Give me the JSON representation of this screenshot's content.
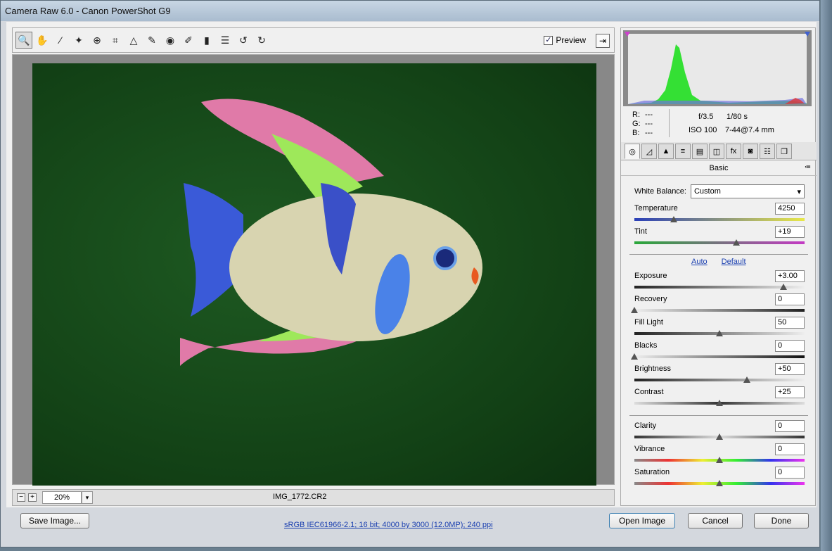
{
  "window": {
    "title": "Camera Raw 6.0  -  Canon PowerShot G9"
  },
  "toolbar": {
    "tools": [
      {
        "name": "zoom-tool",
        "icon": "magnifier-icon",
        "glyph": "🔍"
      },
      {
        "name": "hand-tool",
        "icon": "hand-icon",
        "glyph": "✋"
      },
      {
        "name": "white-balance-tool",
        "icon": "eyedropper-icon",
        "glyph": "⁄"
      },
      {
        "name": "color-sampler-tool",
        "icon": "color-sampler-icon",
        "glyph": "✦"
      },
      {
        "name": "target-adjustment-tool",
        "icon": "target-icon",
        "glyph": "⊕"
      },
      {
        "name": "crop-tool",
        "icon": "crop-icon",
        "glyph": "⌗"
      },
      {
        "name": "straighten-tool",
        "icon": "straighten-icon",
        "glyph": "△"
      },
      {
        "name": "spot-removal-tool",
        "icon": "spot-removal-icon",
        "glyph": "✎"
      },
      {
        "name": "red-eye-tool",
        "icon": "red-eye-icon",
        "glyph": "◉"
      },
      {
        "name": "adjustment-brush-tool",
        "icon": "brush-icon",
        "glyph": "✐"
      },
      {
        "name": "graduated-filter-tool",
        "icon": "gradient-icon",
        "glyph": "▮"
      },
      {
        "name": "preferences-tool",
        "icon": "list-icon",
        "glyph": "☰"
      },
      {
        "name": "rotate-left-tool",
        "icon": "rotate-ccw-icon",
        "glyph": "↺"
      },
      {
        "name": "rotate-right-tool",
        "icon": "rotate-cw-icon",
        "glyph": "↻"
      }
    ],
    "preview_label": "Preview",
    "preview_checked": "✓",
    "fullscreen_glyph": "⇥"
  },
  "statusbar": {
    "zoom_out": "−",
    "zoom_in": "+",
    "zoom_value": "20%",
    "dropdown_glyph": "▾",
    "filename": "IMG_1772.CR2"
  },
  "readout": {
    "r_label": "R:",
    "r_value": "---",
    "g_label": "G:",
    "g_value": "---",
    "b_label": "B:",
    "b_value": "---",
    "aperture": "f/3.5",
    "shutter": "1/80 s",
    "iso": "ISO 100",
    "lens": "7-44@7.4 mm"
  },
  "tabs": [
    "◎",
    "◿",
    "▲",
    "≡",
    "▤",
    "◫",
    "fx",
    "◙",
    "☷",
    "❐"
  ],
  "panel": {
    "title": "Basic",
    "menu_glyph": "≔",
    "white_balance_label": "White Balance:",
    "white_balance_value": "Custom",
    "auto": "Auto",
    "default": "Default"
  },
  "sliders": [
    {
      "key": "temperature",
      "label": "Temperature",
      "value": "4250",
      "pos": 0.23,
      "track": "linear-gradient(90deg,#2a3fb8,#e8e84a)"
    },
    {
      "key": "tint",
      "label": "Tint",
      "value": "+19",
      "pos": 0.6,
      "track": "linear-gradient(90deg,#2aa83a,#c43ac4)"
    },
    {
      "key": "exposure",
      "label": "Exposure",
      "value": "+3.00",
      "pos": 0.875,
      "track": "linear-gradient(90deg,#222,#eee)"
    },
    {
      "key": "recovery",
      "label": "Recovery",
      "value": "0",
      "pos": 0.0,
      "track": "linear-gradient(90deg,#eee,#222)"
    },
    {
      "key": "fill-light",
      "label": "Fill Light",
      "value": "50",
      "pos": 0.5,
      "track": "linear-gradient(90deg,#222,#eee)"
    },
    {
      "key": "blacks",
      "label": "Blacks",
      "value": "0",
      "pos": 0.0,
      "track": "linear-gradient(90deg,#eee,#111)"
    },
    {
      "key": "brightness",
      "label": "Brightness",
      "value": "+50",
      "pos": 0.66,
      "track": "linear-gradient(90deg,#222,#eee)"
    },
    {
      "key": "contrast",
      "label": "Contrast",
      "value": "+25",
      "pos": 0.5,
      "track": "linear-gradient(90deg,#ddd,#333,#ddd)"
    },
    {
      "key": "clarity",
      "label": "Clarity",
      "value": "0",
      "pos": 0.5,
      "track": "linear-gradient(90deg,#333,#ddd,#333)"
    },
    {
      "key": "vibrance",
      "label": "Vibrance",
      "value": "0",
      "pos": 0.5,
      "track": "linear-gradient(90deg,#888,#e33,#ee3,#3e3,#33e,#e3e)"
    },
    {
      "key": "saturation",
      "label": "Saturation",
      "value": "0",
      "pos": 0.5,
      "track": "linear-gradient(90deg,#888,#e33,#ee3,#3e3,#33e,#e3e)"
    }
  ],
  "bottom": {
    "save_image": "Save Image...",
    "info": "sRGB IEC61966-2.1; 16 bit; 4000 by 3000 (12.0MP); 240 ppi",
    "open_image": "Open Image",
    "cancel": "Cancel",
    "done": "Done"
  }
}
